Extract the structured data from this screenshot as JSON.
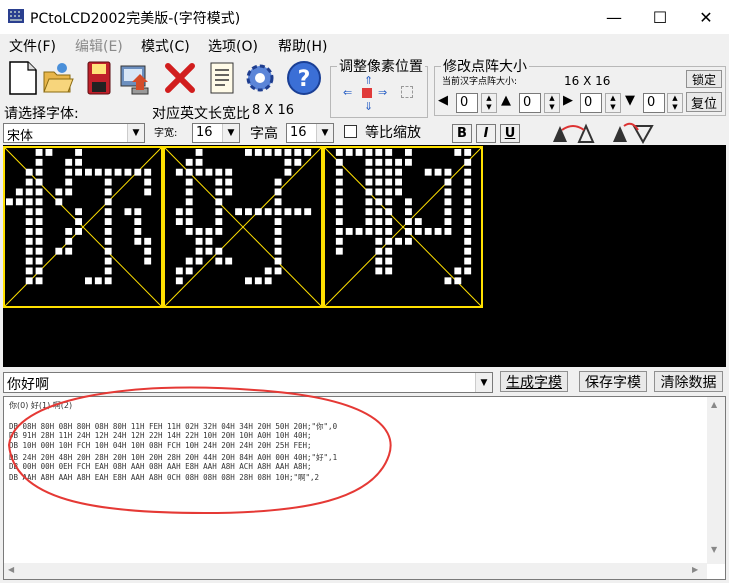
{
  "window": {
    "title": "PCtoLCD2002完美版-(字符模式)",
    "controls": {
      "minimize": "—",
      "maximize": "☐",
      "close": "✕"
    }
  },
  "menu": [
    {
      "label": "文件(F)",
      "enabled": true
    },
    {
      "label": "编辑(E)",
      "enabled": false
    },
    {
      "label": "模式(C)",
      "enabled": true
    },
    {
      "label": "选项(O)",
      "enabled": true
    },
    {
      "label": "帮助(H)",
      "enabled": true
    }
  ],
  "toolbar": {
    "icons": [
      "new-file-icon",
      "open-folder-icon",
      "save-disk-icon",
      "import-image-icon",
      "delete-x-icon",
      "notepad-icon",
      "settings-gear-icon",
      "help-icon"
    ],
    "help_glyph": "?"
  },
  "font_panel": {
    "select_font_label": "请选择字体:",
    "font_value": "宋体",
    "width_ratio_label": "对应英文长宽比",
    "width_ratio_value": "8 X 16",
    "char_width_label": "字宽:",
    "char_width_value": "16",
    "char_height_label": "字高",
    "char_height_value": "16",
    "keep_ratio_label": "等比缩放",
    "bold_label": "B",
    "italic_label": "I",
    "underline_label": "U"
  },
  "adjust_panel": {
    "title": "调整像素位置"
  },
  "matrix_panel": {
    "title": "修改点阵大小",
    "current_size_label": "当前汉字点阵大小:",
    "current_size_value": "16  X  16",
    "lock_button": "锁定",
    "reset_button": "复位",
    "spin_values": [
      "0",
      "0",
      "0",
      "0"
    ]
  },
  "input": {
    "text": "你好啊",
    "generate_button": "生成字模",
    "save_button": "保存字模",
    "clear_button": "清除数据"
  },
  "output": {
    "header": "你(0) 好(1) 啊(2)",
    "lines": [
      "DB 08H 80H 08H 80H 08H 80H 11H FEH 11H 02H 32H 04H 34H 20H 50H 20H;\"你\",0",
      "DB 91H 28H 11H 24H 12H 24H 12H 22H 14H 22H 10H 20H 10H A0H 10H 40H;",
      "DB 10H 00H 10H FCH 10H 04H 10H 08H FCH 10H 24H 20H 24H 20H 25H FEH;",
      "DB 24H 20H 48H 20H 28H 20H 10H 20H 28H 20H 44H 20H 84H A0H 00H 40H;\"好\",1",
      "DB 00H 00H 0EH FCH EAH 08H AAH 08H AAH E8H AAH A8H ACH A8H AAH A8H;",
      "DB AAH A8H AAH A8H EAH E8H AAH A8H 0CH 08H 08H 08H 28H 08H 10H;\"啊\",2"
    ]
  },
  "lcd": {
    "characters": [
      "你",
      "好",
      "啊"
    ],
    "grid_color": "#ffe000",
    "pixel_color": "#ffffff",
    "background": "#000000"
  },
  "annotation_color": "#e53935"
}
